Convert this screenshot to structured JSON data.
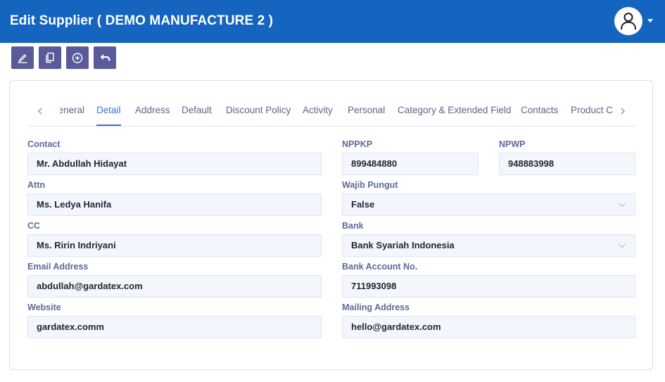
{
  "header": {
    "title": "Edit Supplier ( DEMO MANUFACTURE 2 )",
    "accent": "#1565c0"
  },
  "toolbar": {
    "buttons": [
      {
        "icon": "edit-icon"
      },
      {
        "icon": "copy-icon"
      },
      {
        "icon": "add-circle-icon"
      },
      {
        "icon": "undo-icon"
      }
    ],
    "color": "#5a5a9b"
  },
  "tabs": {
    "items": [
      "General",
      "Detail",
      "Address",
      "Default",
      "Discount Policy",
      "Activity",
      "Personal",
      "Category & Extended Field",
      "Contacts",
      "Product Category"
    ],
    "active": "Detail"
  },
  "form": {
    "contact": {
      "label": "Contact",
      "value": "Mr. Abdullah Hidayat"
    },
    "attn": {
      "label": "Attn",
      "value": "Ms. Ledya Hanifa"
    },
    "cc": {
      "label": "CC",
      "value": "Ms. Ririn Indriyani"
    },
    "email": {
      "label": "Email Address",
      "value": "abdullah@gardatex.com"
    },
    "website": {
      "label": "Website",
      "value": "gardatex.comm"
    },
    "nppkp": {
      "label": "NPPKP",
      "value": "899484880"
    },
    "npwp": {
      "label": "NPWP",
      "value": "948883998"
    },
    "wajib_pungut": {
      "label": "Wajib Pungut",
      "value": "False"
    },
    "bank": {
      "label": "Bank",
      "value": "Bank Syariah Indonesia"
    },
    "bank_account": {
      "label": "Bank Account No.",
      "value": "711993098"
    },
    "mailing_address": {
      "label": "Mailing Address",
      "value": "hello@gardatex.com"
    }
  }
}
